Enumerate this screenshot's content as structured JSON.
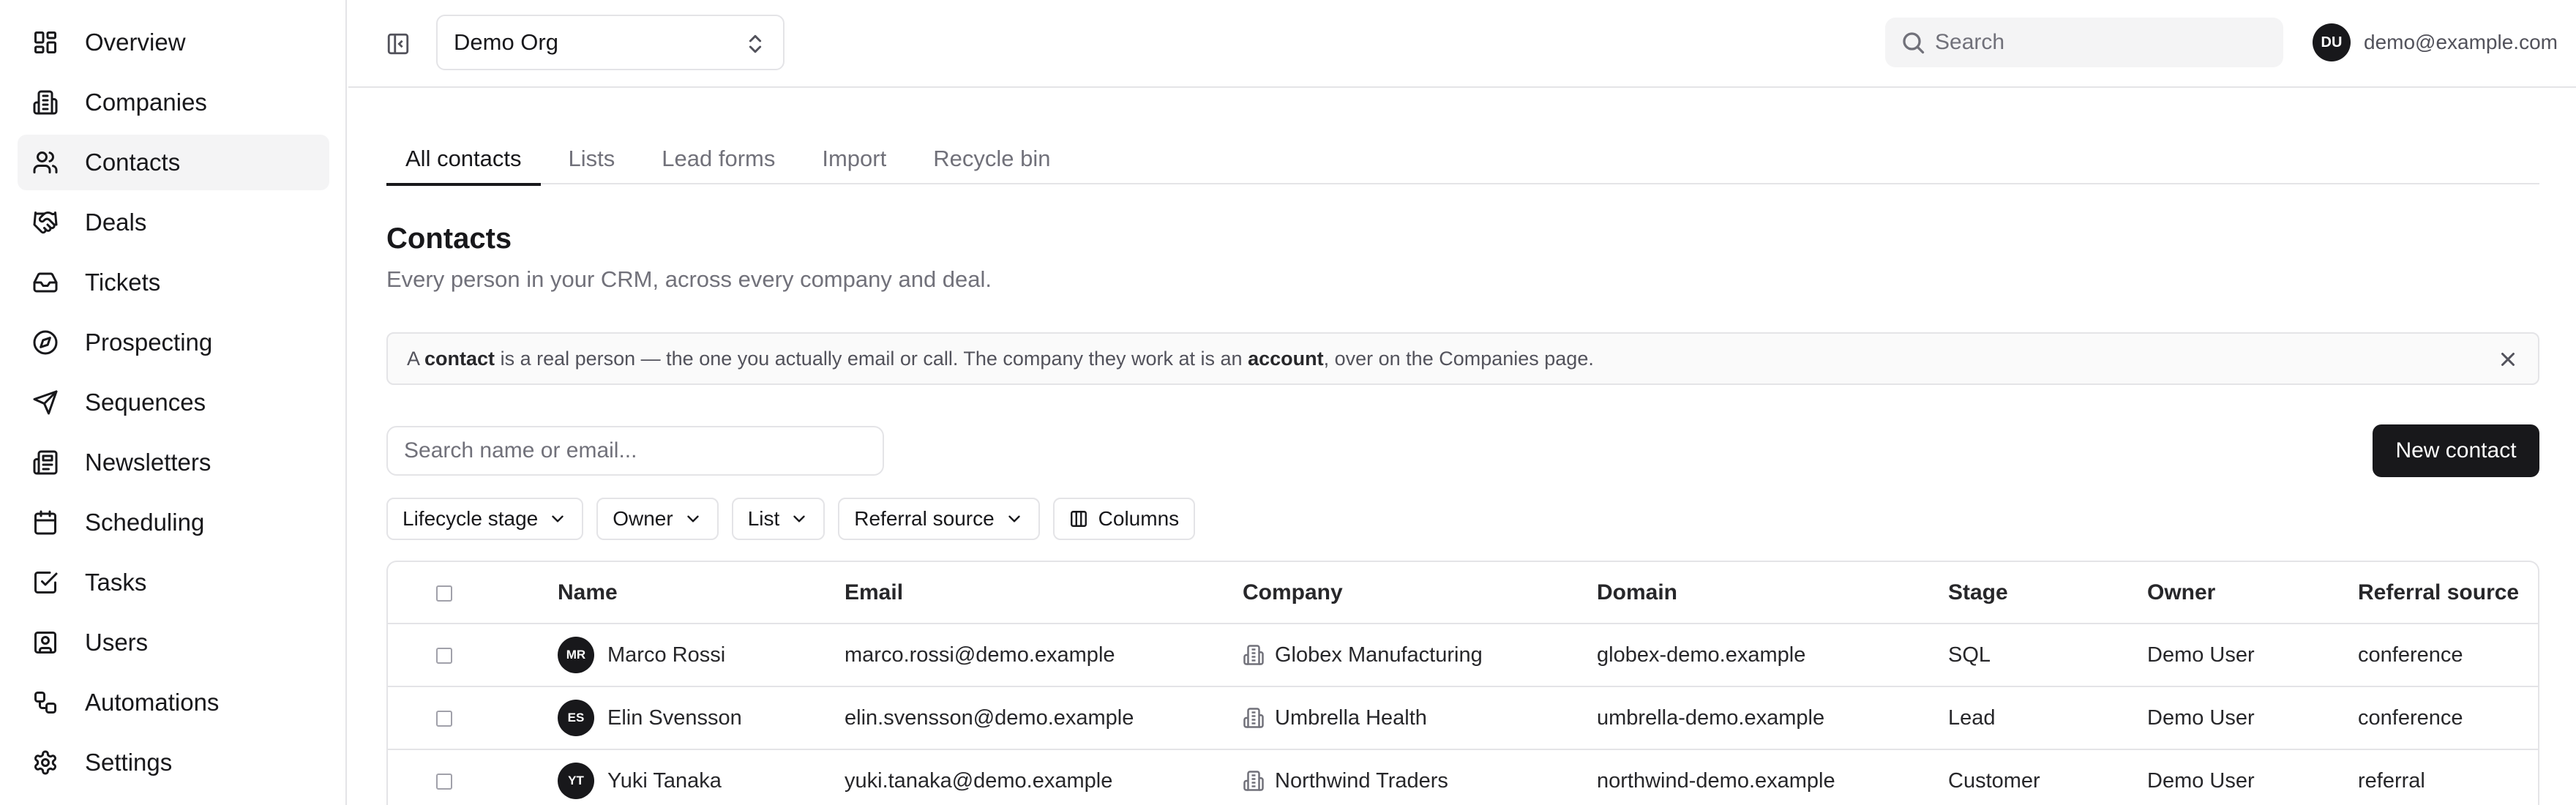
{
  "sidebar": {
    "items": [
      {
        "label": "Overview",
        "icon": "layout-dashboard-icon",
        "active": false
      },
      {
        "label": "Companies",
        "icon": "building-icon",
        "active": false
      },
      {
        "label": "Contacts",
        "icon": "users-icon",
        "active": true
      },
      {
        "label": "Deals",
        "icon": "handshake-icon",
        "active": false
      },
      {
        "label": "Tickets",
        "icon": "inbox-icon",
        "active": false
      },
      {
        "label": "Prospecting",
        "icon": "compass-icon",
        "active": false
      },
      {
        "label": "Sequences",
        "icon": "send-icon",
        "active": false
      },
      {
        "label": "Newsletters",
        "icon": "newspaper-icon",
        "active": false
      },
      {
        "label": "Scheduling",
        "icon": "calendar-icon",
        "active": false
      },
      {
        "label": "Tasks",
        "icon": "check-square-icon",
        "active": false
      },
      {
        "label": "Users",
        "icon": "user-square-icon",
        "active": false
      },
      {
        "label": "Automations",
        "icon": "workflow-icon",
        "active": false
      },
      {
        "label": "Settings",
        "icon": "gear-icon",
        "active": false
      }
    ]
  },
  "topbar": {
    "org_name": "Demo Org",
    "search_placeholder": "Search",
    "user_initials": "DU",
    "user_email": "demo@example.com"
  },
  "tabs": [
    {
      "label": "All contacts",
      "active": true
    },
    {
      "label": "Lists",
      "active": false
    },
    {
      "label": "Lead forms",
      "active": false
    },
    {
      "label": "Import",
      "active": false
    },
    {
      "label": "Recycle bin",
      "active": false
    }
  ],
  "page": {
    "title": "Contacts",
    "subtitle": "Every person in your CRM, across every company and deal."
  },
  "callout": {
    "part1": "A ",
    "bold1": "contact",
    "part2": " is a real person — the one you actually email or call. The company they work at is an ",
    "bold2": "account",
    "part3": ", over on the Companies page."
  },
  "toolbar": {
    "search_placeholder": "Search name or email...",
    "new_contact_label": "New contact"
  },
  "filters": {
    "lifecycle": "Lifecycle stage",
    "owner": "Owner",
    "list": "List",
    "referral": "Referral source",
    "columns": "Columns"
  },
  "table": {
    "headers": {
      "name": "Name",
      "email": "Email",
      "company": "Company",
      "domain": "Domain",
      "stage": "Stage",
      "owner": "Owner",
      "referral": "Referral source"
    },
    "rows": [
      {
        "initials": "MR",
        "name": "Marco Rossi",
        "email": "marco.rossi@demo.example",
        "company": "Globex Manufacturing",
        "domain": "globex-demo.example",
        "stage": "SQL",
        "owner": "Demo User",
        "referral": "conference"
      },
      {
        "initials": "ES",
        "name": "Elin Svensson",
        "email": "elin.svensson@demo.example",
        "company": "Umbrella Health",
        "domain": "umbrella-demo.example",
        "stage": "Lead",
        "owner": "Demo User",
        "referral": "conference"
      },
      {
        "initials": "YT",
        "name": "Yuki Tanaka",
        "email": "yuki.tanaka@demo.example",
        "company": "Northwind Traders",
        "domain": "northwind-demo.example",
        "stage": "Customer",
        "owner": "Demo User",
        "referral": "referral"
      }
    ]
  }
}
